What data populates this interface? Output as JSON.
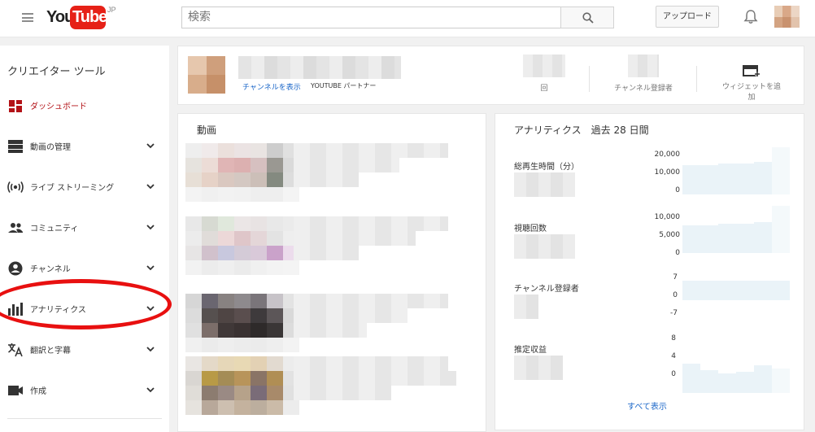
{
  "header": {
    "logo_you": "You",
    "logo_tube": "Tube",
    "logo_region": "JP",
    "search_placeholder": "検索",
    "upload_label": "アップロード"
  },
  "sidebar": {
    "title": "クリエイター ツール",
    "items": [
      {
        "label": "ダッシュボード",
        "icon": "dashboard-icon",
        "active": true
      },
      {
        "label": "動画の管理",
        "icon": "video-manager-icon"
      },
      {
        "label": "ライブ ストリーミング",
        "icon": "live-streaming-icon"
      },
      {
        "label": "コミュニティ",
        "icon": "community-icon"
      },
      {
        "label": "チャンネル",
        "icon": "channel-icon"
      },
      {
        "label": "アナリティクス",
        "icon": "analytics-icon"
      },
      {
        "label": "翻訳と字幕",
        "icon": "translate-icon"
      },
      {
        "label": "作成",
        "icon": "create-icon"
      }
    ],
    "accent_color": "#b31217"
  },
  "channel": {
    "view_channel_link": "チャンネルを表示",
    "partner_label": "YOUTUBE パートナー",
    "stats": [
      {
        "label": "回"
      },
      {
        "label": "チャンネル登録者"
      }
    ],
    "add_widget_label": "ウィジェットを追加"
  },
  "videos": {
    "title": "動画"
  },
  "analytics": {
    "title": "アナリティクス　過去 28 日間",
    "metrics": [
      {
        "label": "総再生時間（分）",
        "ticks": [
          "20,000",
          "10,000",
          "0"
        ]
      },
      {
        "label": "視聴回数",
        "ticks": [
          "10,000",
          "5,000",
          "0"
        ]
      },
      {
        "label": "チャンネル登録者",
        "ticks": [
          "7",
          "0",
          "-7"
        ]
      },
      {
        "label": "推定収益",
        "ticks": [
          "8",
          "4",
          "0"
        ]
      }
    ],
    "see_all": "すべて表示"
  },
  "annotation": {
    "color": "#e81010",
    "highlights": "analytics-menu-item"
  }
}
